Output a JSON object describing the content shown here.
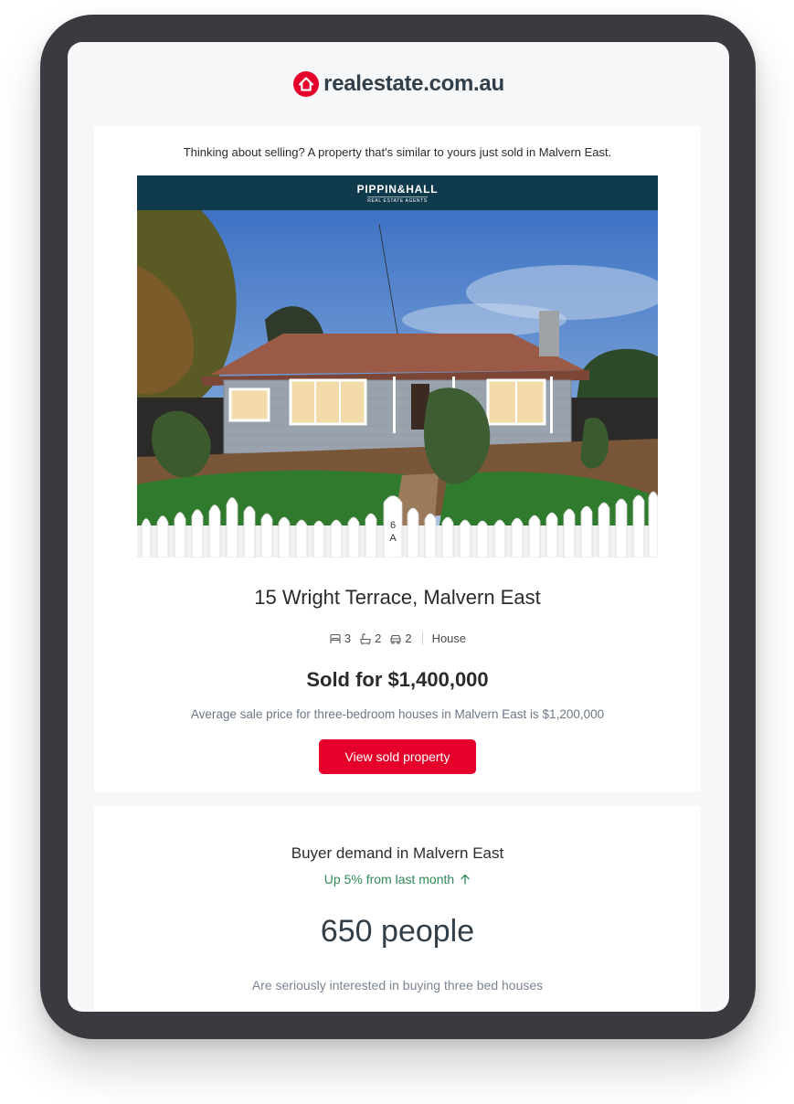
{
  "header": {
    "brand_name": "realestate.com.au",
    "brand_color": "#e4002b"
  },
  "listing": {
    "intro": "Thinking about selling? A property that's similar to yours just sold in Malvern East.",
    "agency": {
      "name": "PIPPIN&HALL",
      "tagline": "REAL ESTATE AGENTS",
      "bar_color": "#0e3a4b"
    },
    "photo_house_number": "6\nA",
    "address": "15 Wright Terrace, Malvern East",
    "features": {
      "bedrooms": "3",
      "bedroom_icon": "bed-icon",
      "bathrooms": "2",
      "bathroom_icon": "bath-icon",
      "car_spaces": "2",
      "car_icon": "car-icon",
      "property_type": "House"
    },
    "sold_price": "Sold for $1,400,000",
    "average_note": "Average sale price for three-bedroom houses in Malvern East is $1,200,000",
    "cta_label": "View sold property",
    "cta_color": "#e4002b"
  },
  "demand": {
    "title": "Buyer demand in Malvern East",
    "trend": "Up 5% from last month",
    "trend_icon": "arrow-up-icon",
    "trend_color": "#2f8a55",
    "count": "650 people",
    "description": "Are seriously interested in buying three bed houses"
  }
}
